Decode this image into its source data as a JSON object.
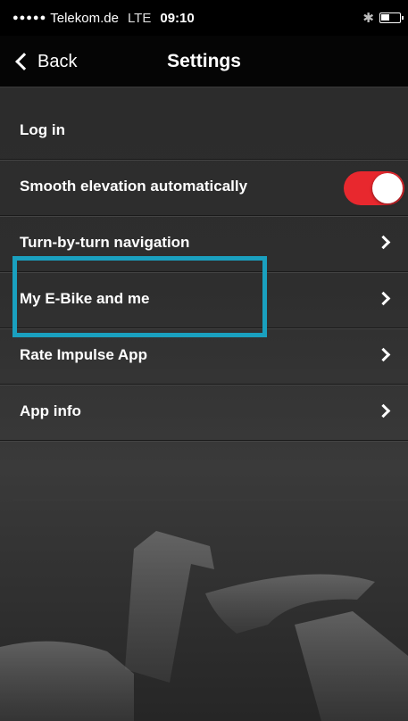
{
  "status_bar": {
    "signal": "●●●●●",
    "carrier": "Telekom.de",
    "network": "LTE",
    "time": "09:10",
    "bluetooth": "✱"
  },
  "nav": {
    "back_label": "Back",
    "title": "Settings"
  },
  "settings": {
    "login": "Log in",
    "smooth_elevation": "Smooth elevation automatically",
    "smooth_elevation_on": true,
    "turn_by_turn": "Turn-by-turn navigation",
    "my_ebike": "My E-Bike and me",
    "rate_app": "Rate Impulse App",
    "app_info": "App info"
  },
  "colors": {
    "toggle_on": "#e8282e",
    "highlight": "#1aa0bf"
  }
}
